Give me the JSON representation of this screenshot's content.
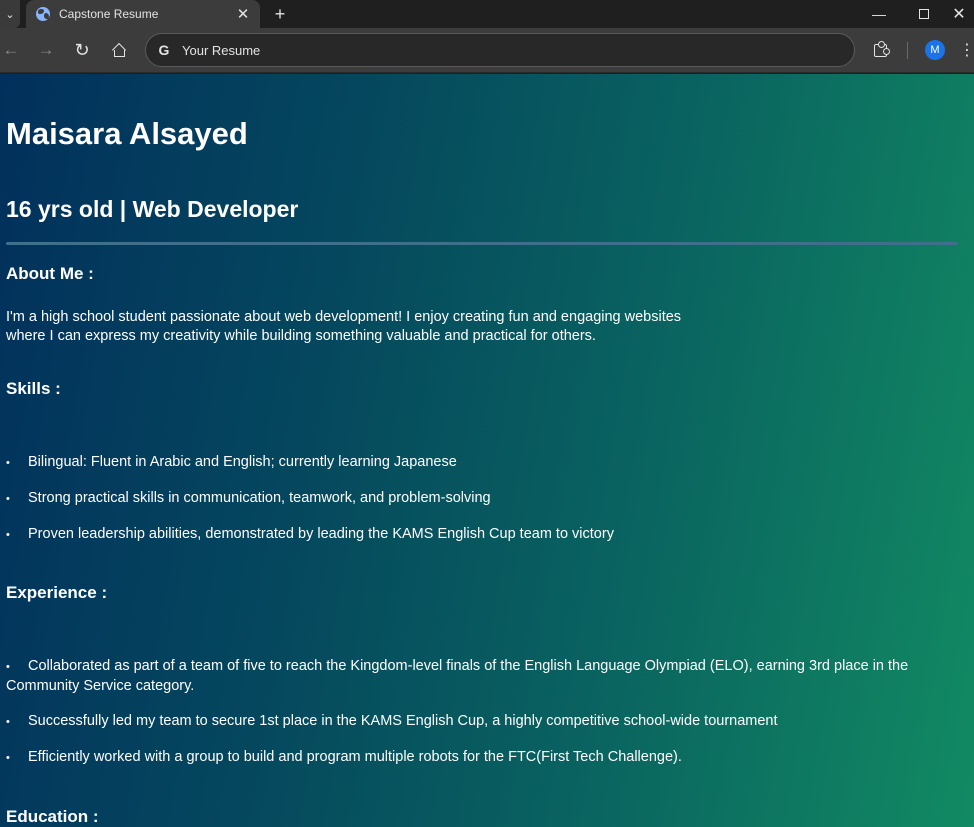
{
  "browser": {
    "tab_title": "Capstone Resume",
    "tab_close": "✕",
    "new_tab": "+",
    "address": "Your Resume",
    "profile_initial": "M",
    "google_glyph": "G"
  },
  "resume": {
    "name": "Maisara Alsayed",
    "subtitle": "16 yrs old | Web Developer",
    "about_heading": "About Me :",
    "about_text_line1": "I'm a high school student passionate about web development! I enjoy creating fun and engaging websites",
    "about_text_line2": "where I can express my creativity while building something valuable and practical for others.",
    "skills_heading": "Skills :",
    "skills": [
      "Bilingual: Fluent in Arabic and English; currently learning Japanese",
      "Strong practical skills in communication, teamwork, and problem-solving",
      "Proven leadership abilities, demonstrated by leading the KAMS English Cup team to victory"
    ],
    "experience_heading": "Experience :",
    "experience": [
      "Collaborated as part of a team of five to reach the Kingdom-level finals of the English Language Olympiad (ELO), earning 3rd place in the Community Service category.",
      "Successfully led my team to secure 1st place in the KAMS English Cup, a highly competitive school-wide tournament",
      "Efficiently worked with a group to build and program multiple robots for the FTC(First Tech Challenge)."
    ],
    "education_heading": "Education :"
  },
  "colors": {
    "gradient_start": "#02305c",
    "gradient_end": "#128a62",
    "rule": "#3f6f8a",
    "profile": "#1a73e8"
  }
}
